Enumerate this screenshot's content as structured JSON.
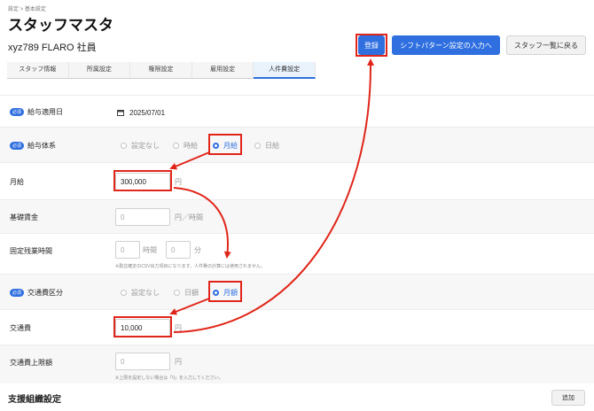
{
  "breadcrumb": "設定 > 基本設定",
  "page_title": "スタッフマスタ",
  "staff_name": "xyz789 FLARO 社員",
  "buttons": {
    "register": "登録",
    "shift_pattern": "シフトパターン設定の入力へ",
    "back_to_list": "スタッフ一覧に戻る",
    "add": "追加"
  },
  "tabs": [
    "スタッフ情報",
    "所属設定",
    "権限設定",
    "雇用設定",
    "人件費設定"
  ],
  "active_tab": "人件費設定",
  "required_badge": "必須",
  "fields": {
    "salary_start_date": {
      "label": "給与適用日",
      "value": "2025/07/01"
    },
    "salary_system": {
      "label": "給与体系",
      "options": [
        "設定なし",
        "時給",
        "月給",
        "日給"
      ],
      "selected": "月給"
    },
    "monthly_salary": {
      "label": "月給",
      "value": "300,000",
      "unit": "円"
    },
    "base_wage": {
      "label": "基礎賃金",
      "placeholder": "0",
      "unit": "円／時間"
    },
    "fixed_overtime": {
      "label": "固定残業時間",
      "hours_placeholder": "0",
      "hours_unit": "時間",
      "minutes_placeholder": "0",
      "minutes_unit": "分",
      "note": "※勤怠確定のCSV出力項目になります。人件費の計算には使用されません。"
    },
    "transport_type": {
      "label": "交通費区分",
      "options": [
        "設定なし",
        "日額",
        "月額"
      ],
      "selected": "月額"
    },
    "transport_cost": {
      "label": "交通費",
      "value": "10,000",
      "unit": "円"
    },
    "transport_limit": {
      "label": "交通費上限額",
      "placeholder": "0",
      "unit": "円",
      "note": "※上限を設定しない場合は「0」を入力してください。"
    }
  },
  "support_section": {
    "title": "支援組織設定"
  },
  "annotation_color": "#e0261a",
  "accent_color": "#2f6fe0"
}
